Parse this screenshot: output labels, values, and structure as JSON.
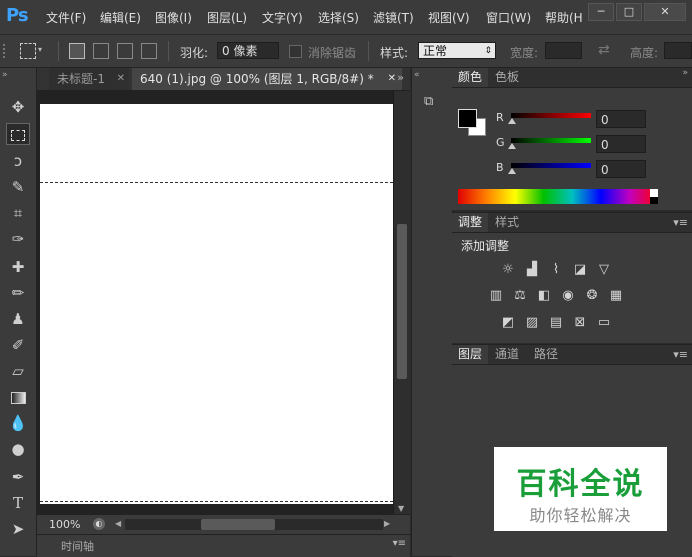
{
  "app": {
    "logo": "Ps"
  },
  "menubar": {
    "items": [
      "文件(F)",
      "编辑(E)",
      "图像(I)",
      "图层(L)",
      "文字(Y)",
      "选择(S)",
      "滤镜(T)",
      "视图(V)",
      "窗口(W)",
      "帮助(H"
    ],
    "window_buttons": [
      "─",
      "□",
      "✕"
    ]
  },
  "options": {
    "feather_label": "羽化:",
    "feather_value": "0 像素",
    "antialias_label": "消除锯齿",
    "style_label": "样式:",
    "style_value": "正常",
    "width_label": "宽度:",
    "height_label": "高度:"
  },
  "tabs": [
    {
      "label": "未标题-1",
      "close": "✕",
      "active": false
    },
    {
      "label": "640 (1).jpg @ 100% (图层 1, RGB/8#) *",
      "close": "✕",
      "active": true
    }
  ],
  "tabbar_overflow": "»",
  "status": {
    "zoom": "100%"
  },
  "timeline": {
    "label": "时间轴"
  },
  "color_panel": {
    "tabs": [
      "颜色",
      "色板"
    ],
    "channels": [
      {
        "label": "R",
        "value": "0"
      },
      {
        "label": "G",
        "value": "0"
      },
      {
        "label": "B",
        "value": "0"
      }
    ],
    "foreground": "#000000",
    "background": "#ffffff"
  },
  "adjust_panel": {
    "tabs": [
      "调整",
      "样式"
    ],
    "title": "添加调整",
    "icons_row1": [
      "brightness-icon",
      "levels-icon",
      "curves-icon",
      "exposure-icon",
      "vibrance-icon"
    ],
    "icons_row2": [
      "hue-saturation-icon",
      "color-balance-icon",
      "black-white-icon",
      "photo-filter-icon",
      "channel-mixer-icon",
      "color-lookup-icon"
    ],
    "icons_row3": [
      "invert-icon",
      "posterize-icon",
      "threshold-icon",
      "selective-color-icon",
      "gradient-map-icon"
    ]
  },
  "layers_panel": {
    "tabs": [
      "图层",
      "通道",
      "路径"
    ]
  },
  "watermark": {
    "title": "百科全说",
    "subtitle": "助你轻松解决"
  },
  "colors": {
    "accent": "#3da3ff",
    "panel_bg": "#3b3b3b",
    "watermark_green": "#1a9e3a"
  }
}
